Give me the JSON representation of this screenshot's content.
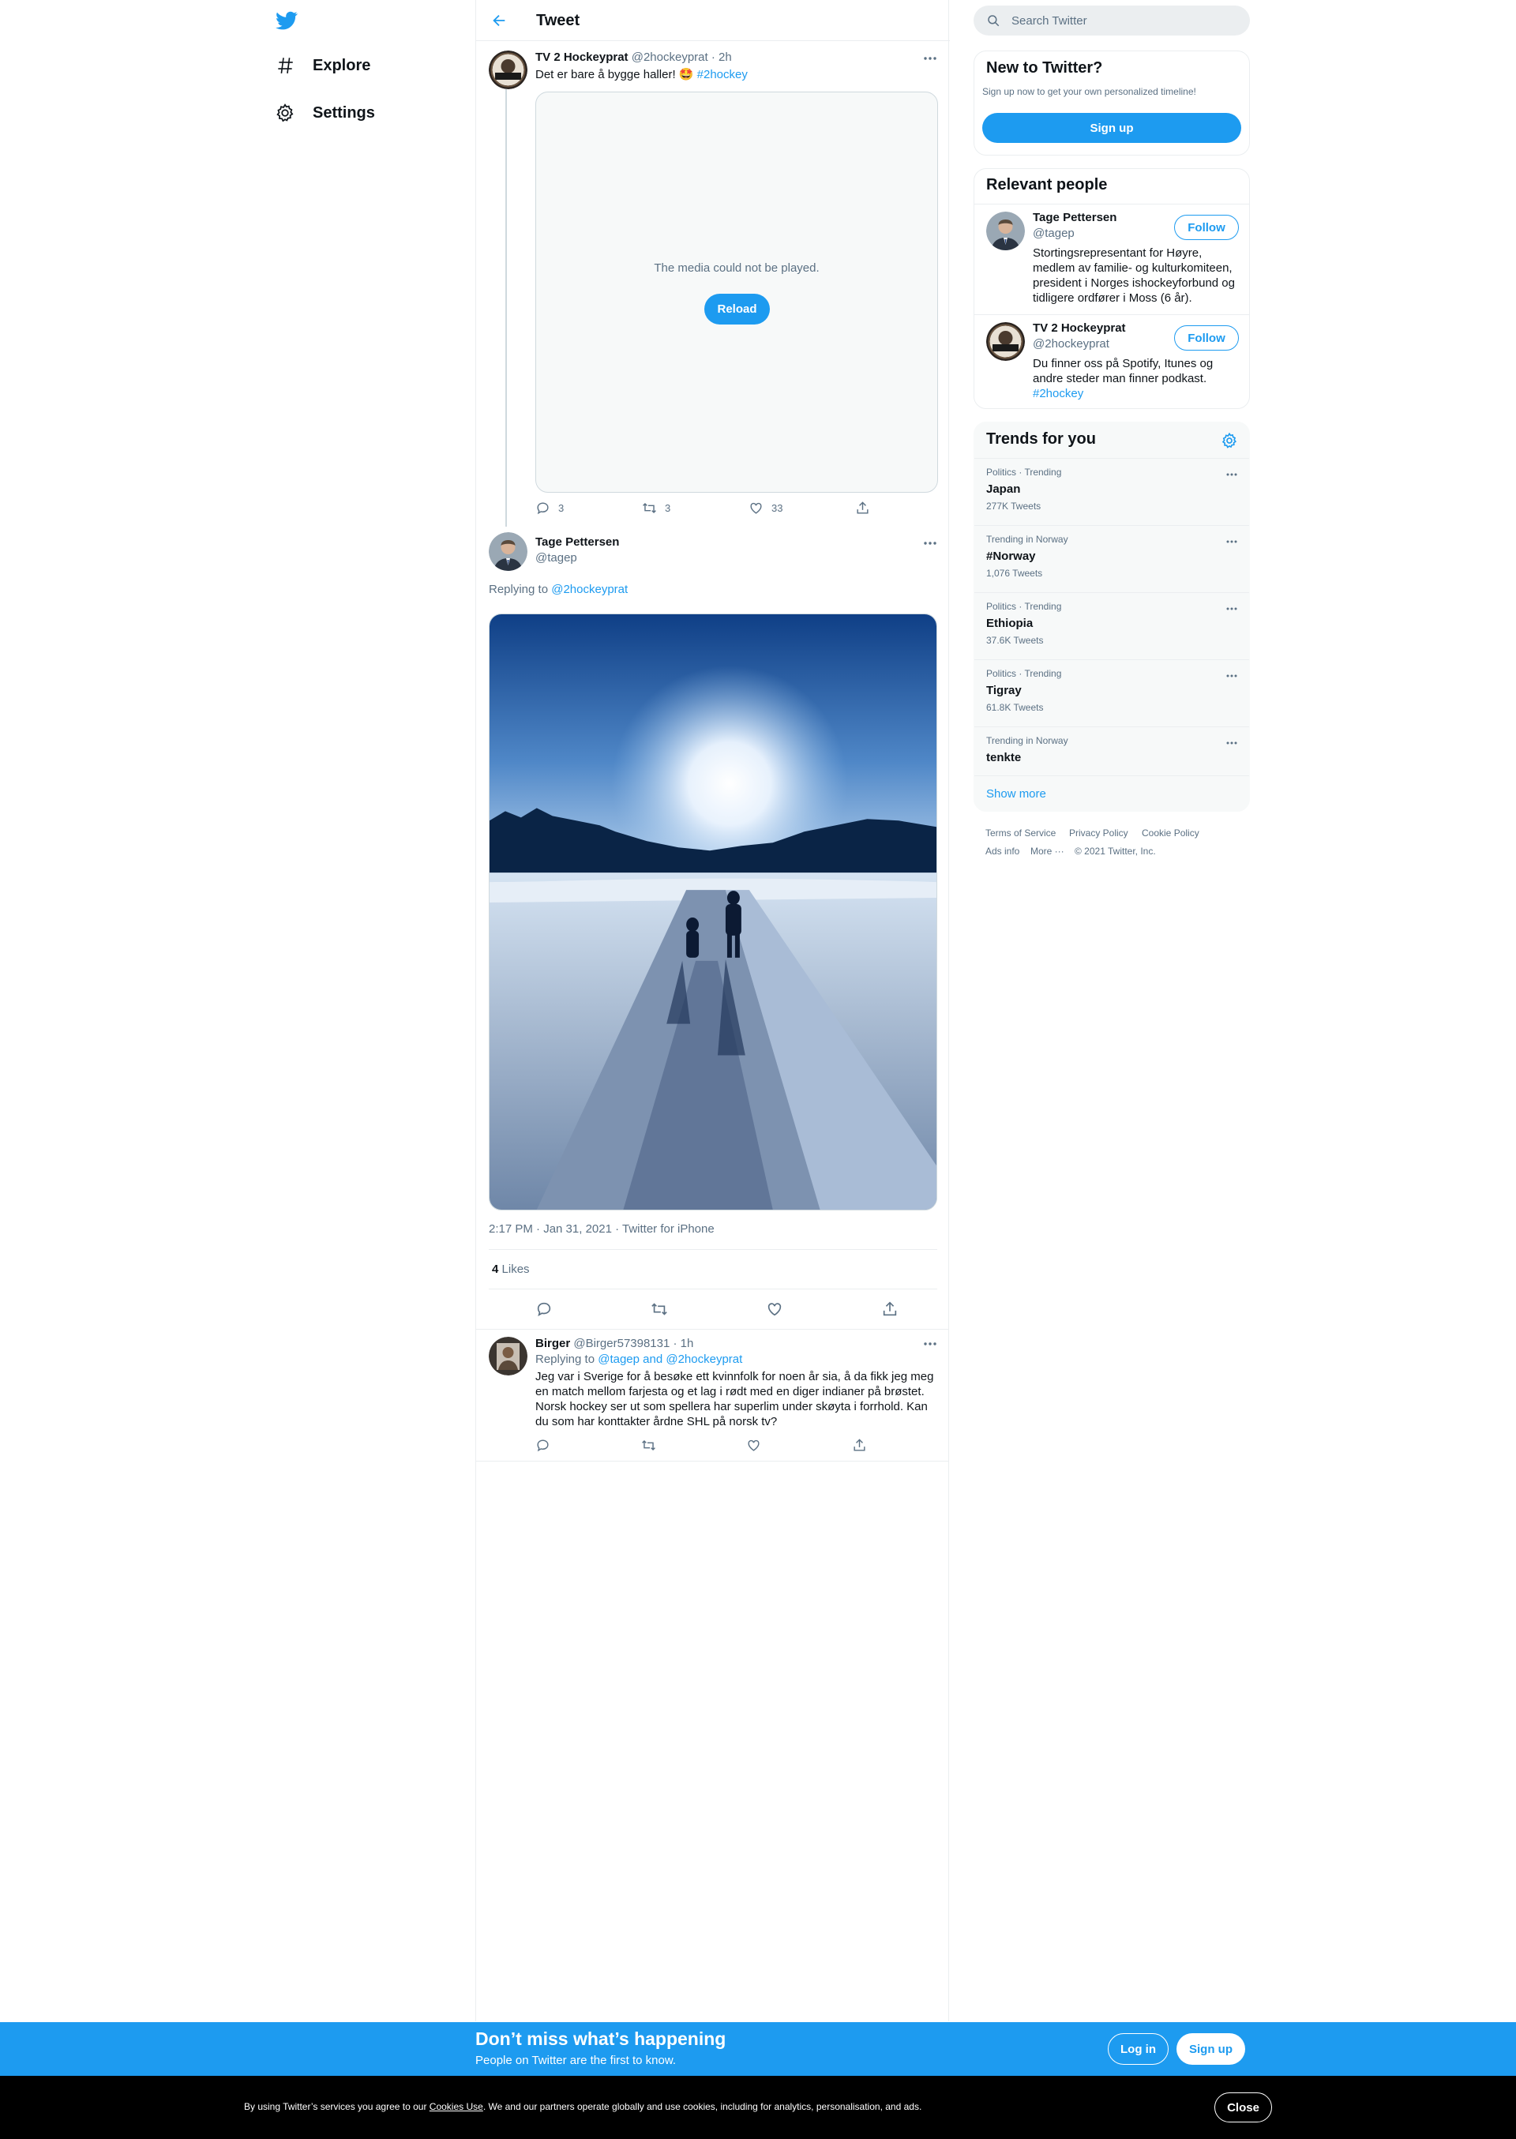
{
  "nav": {
    "items": [
      {
        "label": "Explore",
        "icon": "hashtag-icon"
      },
      {
        "label": "Settings",
        "icon": "gear-icon"
      }
    ]
  },
  "header": {
    "title": "Tweet"
  },
  "tweet1": {
    "name": "TV 2 Hockeyprat",
    "handle": "@2hockeyprat",
    "time": "· 2h",
    "text": "Det er bare å bygge haller!",
    "emoji": "🤩",
    "hashtag": "#2hockey",
    "media_message": "The media could not be played.",
    "reload_label": "Reload",
    "replies": "3",
    "retweets": "3",
    "likes": "33"
  },
  "main_tweet": {
    "name": "Tage Pettersen",
    "handle": "@tagep",
    "replying_prefix": "Replying to",
    "replying_to": "@2hockeyprat",
    "timestamp": "2:17 PM · Jan 31, 2021 · Twitter for iPhone",
    "likes_count": "4",
    "likes_label": "Likes"
  },
  "reply": {
    "name": "Birger",
    "handle": "@Birger57398131",
    "time": "· 1h",
    "replying_prefix": "Replying to",
    "replying_to": "@tagep and @2hockeyprat",
    "text": "Jeg var i Sverige for å besøke ett kvinnfolk for noen år sia, å da fikk jeg meg en match mellom farjesta og et lag i rødt med en diger indianer på brøstet. Norsk hockey ser ut som spellera har superlim under skøyta i forrhold. Kan du som har konttakter årdne SHL på norsk tv?"
  },
  "search": {
    "placeholder": "Search Twitter"
  },
  "new_to_twitter": {
    "title": "New to Twitter?",
    "subtitle": "Sign up now to get your own personalized timeline!",
    "button": "Sign up"
  },
  "relevant": {
    "title": "Relevant people",
    "people": [
      {
        "name": "Tage Pettersen",
        "handle": "@tagep",
        "button": "Follow",
        "bio": "Stortingsrepresentant for Høyre, medlem av familie- og kulturkomiteen, president i Norges ishockeyforbund og tidligere ordfører i Moss (6 år)."
      },
      {
        "name": "TV 2 Hockeyprat",
        "handle": "@2hockeyprat",
        "button": "Follow",
        "bio": "Du finner oss på Spotify, Itunes og andre steder man finner podkast.",
        "bio_link": "#2hockey"
      }
    ]
  },
  "trends": {
    "title": "Trends for you",
    "items": [
      {
        "category": "Politics · Trending",
        "name": "Japan",
        "count": "277K Tweets"
      },
      {
        "category": "Trending in Norway",
        "name": "#Norway",
        "count": "1,076 Tweets"
      },
      {
        "category": "Politics · Trending",
        "name": "Ethiopia",
        "count": "37.6K Tweets"
      },
      {
        "category": "Politics · Trending",
        "name": "Tigray",
        "count": "61.8K Tweets"
      },
      {
        "category": "Trending in Norway",
        "name": "tenkte",
        "count": ""
      }
    ],
    "show_more": "Show more"
  },
  "footer": {
    "terms": "Terms of Service",
    "privacy": "Privacy Policy",
    "cookie": "Cookie Policy",
    "ads": "Ads info",
    "more": "More ···",
    "copyright": "© 2021 Twitter, Inc."
  },
  "promo": {
    "title": "Don’t miss what’s happening",
    "subtitle": "People on Twitter are the first to know.",
    "login": "Log in",
    "signup": "Sign up"
  },
  "cookie_bar": {
    "text_before": "By using Twitter’s services you agree to our",
    "link": "Cookies Use",
    "text_after": ". We and our partners operate globally and use cookies, including for analytics, personalisation, and ads.",
    "close": "Close"
  },
  "colors": {
    "accent": "#1d9bf0",
    "text": "#0f1419",
    "secondary": "#5b7083",
    "border": "#ebeef0"
  }
}
